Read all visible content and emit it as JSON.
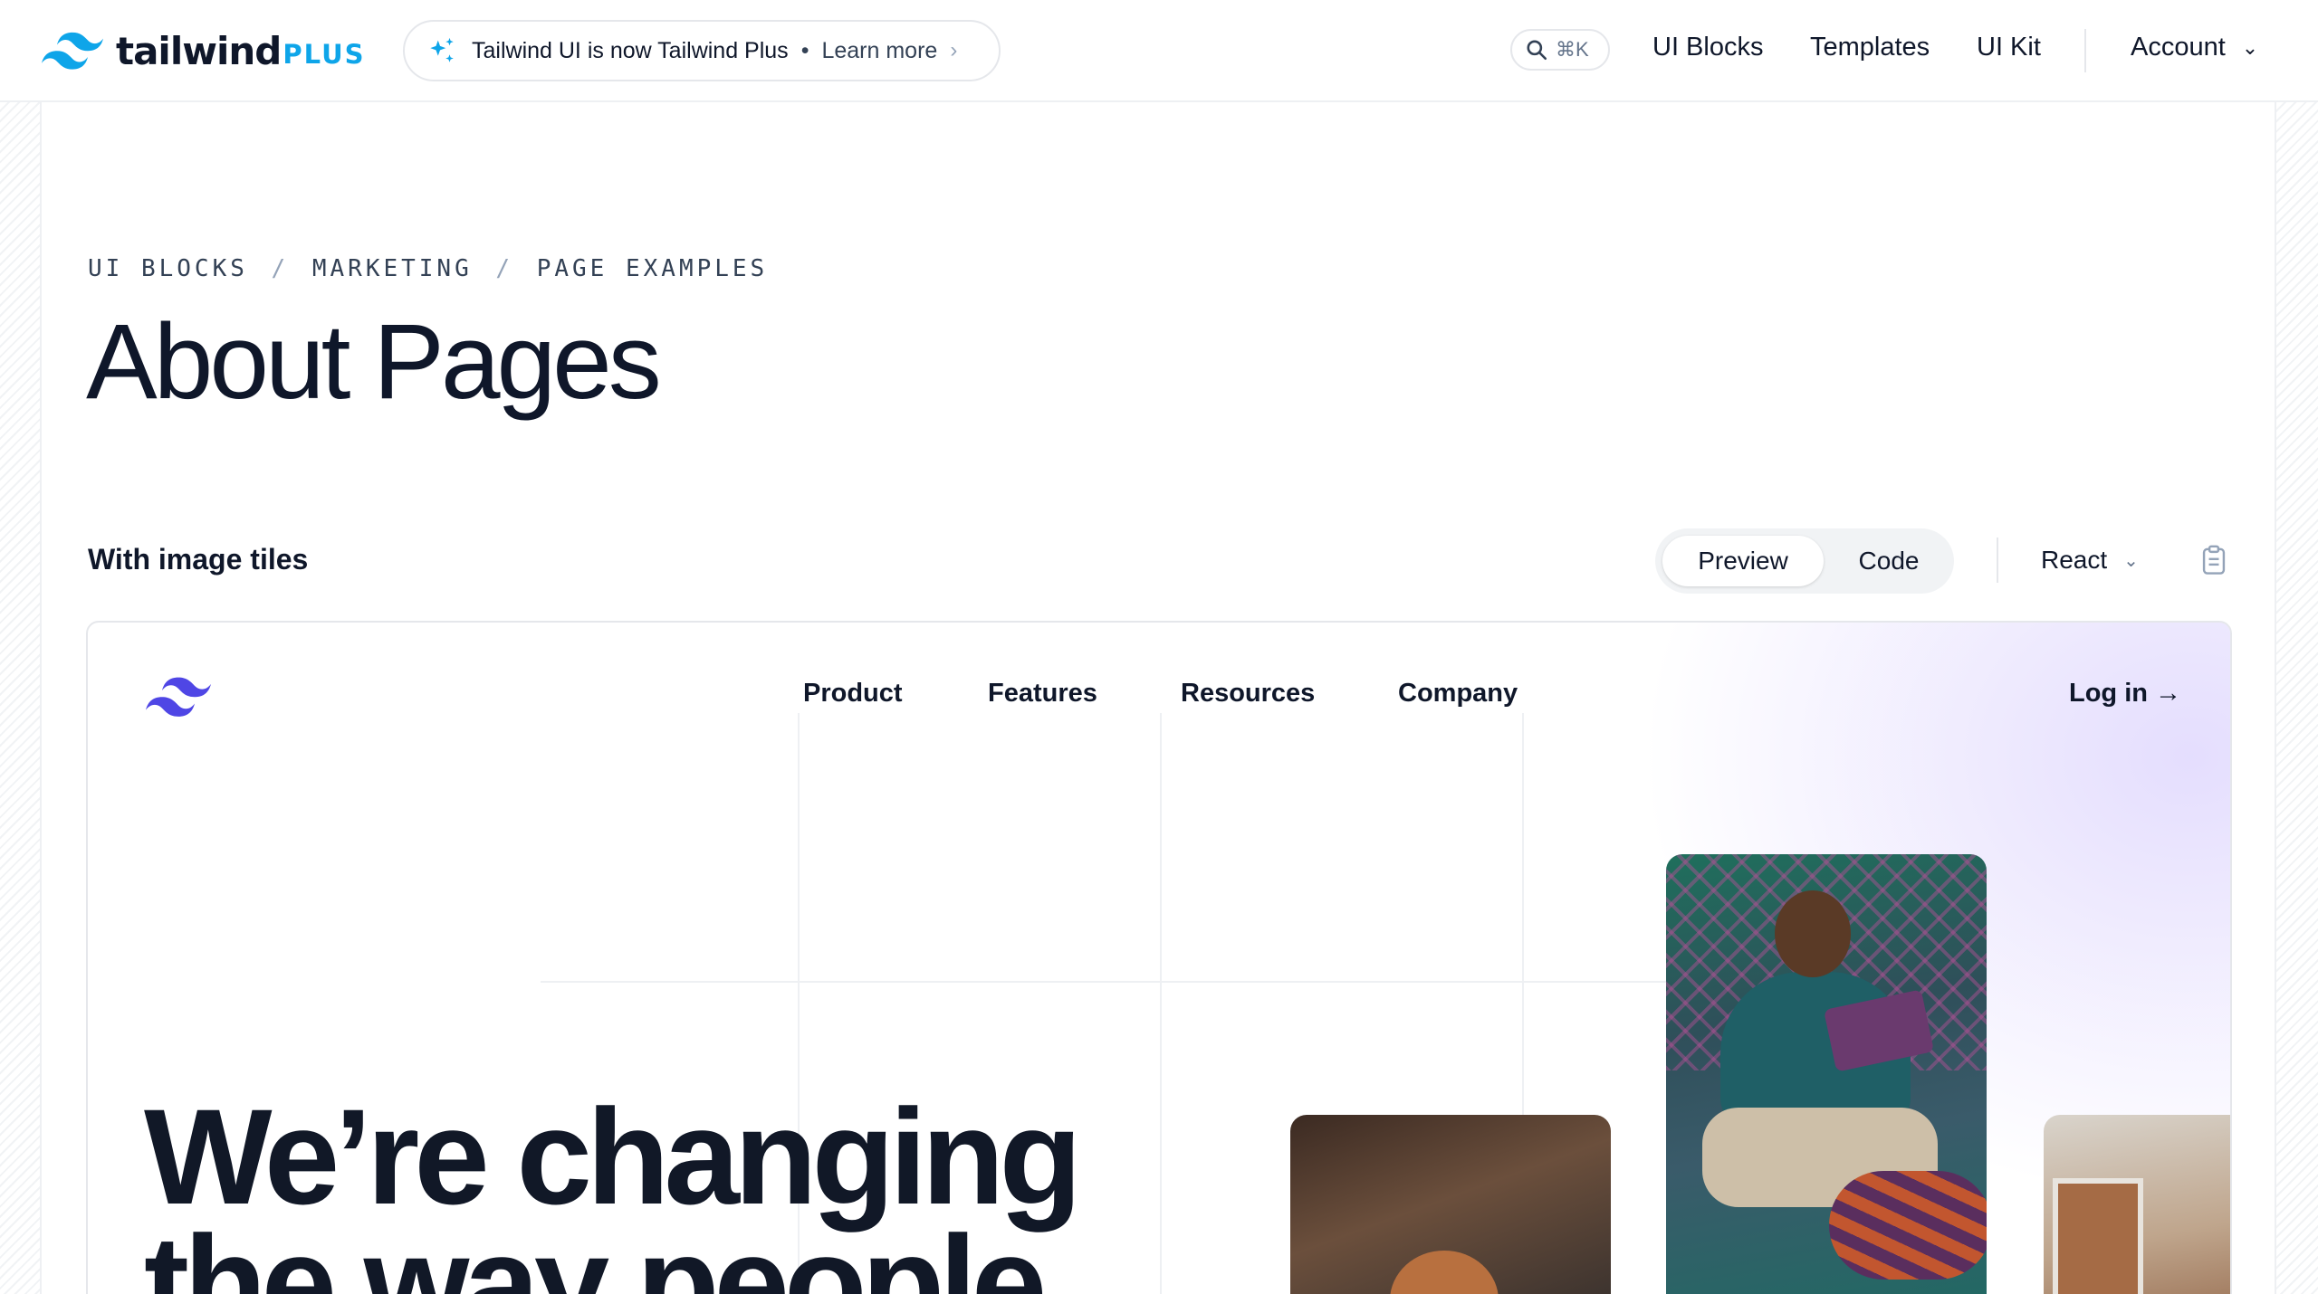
{
  "topnav": {
    "logo_word": "tailwind",
    "logo_plus": "PLUS",
    "announcement": {
      "text": "Tailwind UI is now Tailwind Plus",
      "separator": "•",
      "link": "Learn more"
    },
    "search_shortcut": "⌘K",
    "links": [
      "UI Blocks",
      "Templates",
      "UI Kit"
    ],
    "account_label": "Account"
  },
  "breadcrumb": [
    "UI BLOCKS",
    "MARKETING",
    "PAGE EXAMPLES"
  ],
  "breadcrumb_separator": "/",
  "page_title": "About Pages",
  "section": {
    "title": "With image tiles",
    "view_toggle": {
      "preview": "Preview",
      "code": "Code",
      "selected": "Preview"
    },
    "framework": "React"
  },
  "preview": {
    "nav": [
      "Product",
      "Features",
      "Resources",
      "Company"
    ],
    "login": "Log in →",
    "hero_line1": "We’re changing",
    "hero_line2": "the way people"
  },
  "colors": {
    "brand": "#0ea5e9",
    "preview_logo": "#4f46e5",
    "text": "#0f172a"
  }
}
